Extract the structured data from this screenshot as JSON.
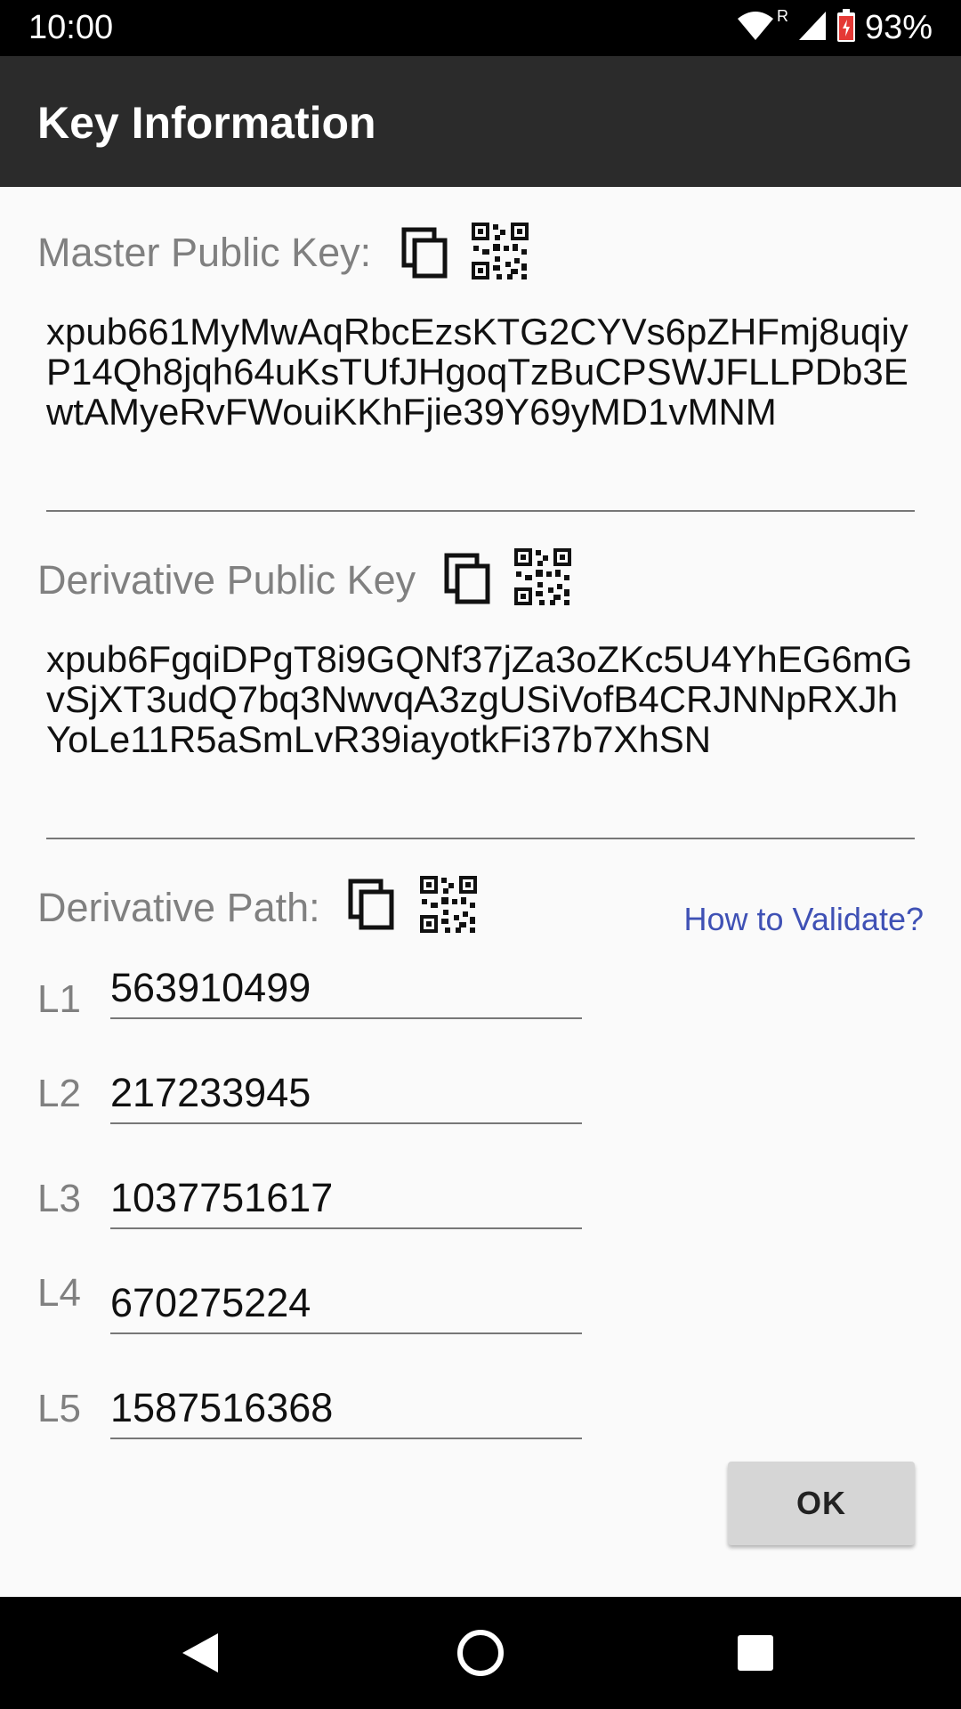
{
  "status_bar": {
    "time": "10:00",
    "roaming_indicator": "R",
    "battery_percent": "93%",
    "icons": [
      "wifi-icon",
      "cell-signal-icon",
      "battery-charging-icon"
    ]
  },
  "app_bar": {
    "title": "Key Information"
  },
  "master_key": {
    "label": "Master Public Key:",
    "value": "xpub661MyMwAqRbcEzsKTG2CYVs6pZHFmj8uqiyP14Qh8jqh64uKsTUfJHgoqTzBuCPSWJFLLPDb3EwtAMyeRvFWouiKKhFjie39Y69yMD1vMNM",
    "icons": [
      "copy-icon",
      "qr-code-icon"
    ]
  },
  "derivative_key": {
    "label": "Derivative Public Key",
    "value": "xpub6FgqiDPgT8i9GQNf37jZa3oZKc5U4YhEG6mGvSjXT3udQ7bq3NwvqA3zgUSiVofB4CRJNNpRXJhYoLe11R5aSmLvR39iayotkFi37b7XhSN",
    "icons": [
      "copy-icon",
      "qr-code-icon"
    ]
  },
  "derivative_path": {
    "label": "Derivative Path:",
    "link": "How to Validate?",
    "levels": [
      {
        "label": "L1",
        "value": "563910499"
      },
      {
        "label": "L2",
        "value": "217233945"
      },
      {
        "label": "L3",
        "value": "1037751617"
      },
      {
        "label": "L4",
        "value": "670275224"
      },
      {
        "label": "L5",
        "value": "1587516368"
      }
    ]
  },
  "actions": {
    "ok_label": "OK"
  },
  "nav_bar": {
    "icons": [
      "back-icon",
      "home-icon",
      "recents-icon"
    ]
  },
  "colors": {
    "app_bar": "#2b2b2b",
    "link": "#3f51b5",
    "label": "#808080",
    "background": "#fafafa"
  }
}
